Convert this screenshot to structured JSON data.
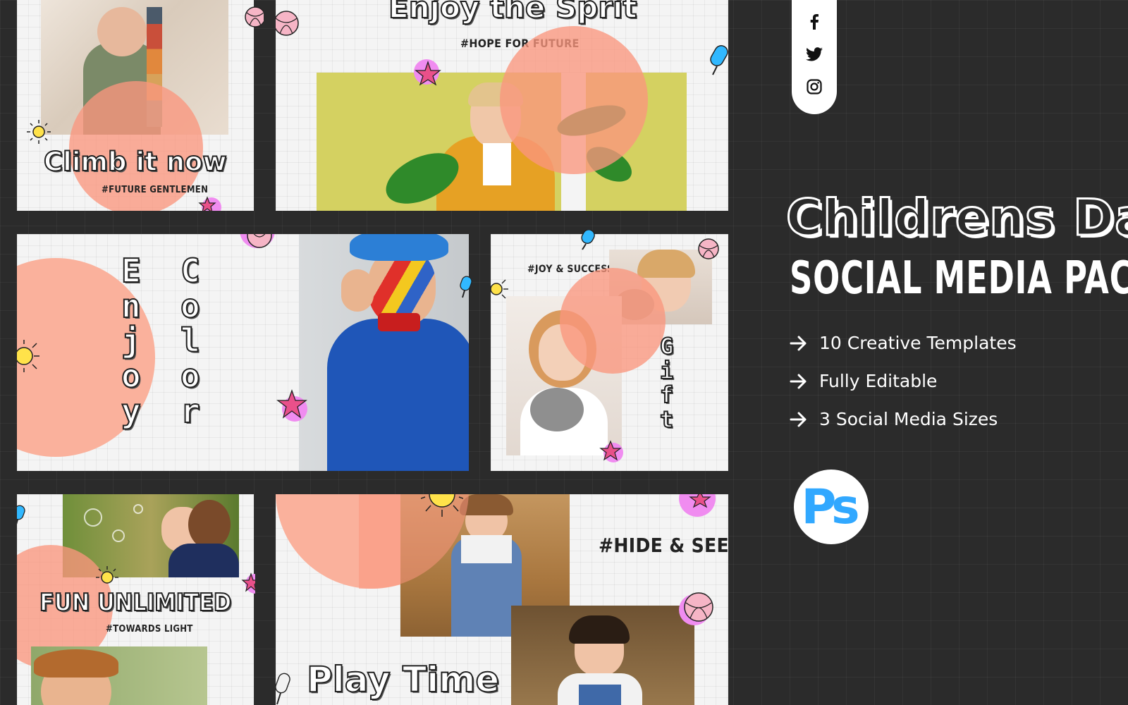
{
  "social": {
    "facebook_icon": "facebook-icon",
    "twitter_icon": "twitter-icon",
    "instagram_icon": "instagram-icon"
  },
  "product": {
    "title": "Childrens Day",
    "subtitle": "SOCIAL MEDIA PACK",
    "features": [
      "10 Creative Templates",
      "Fully Editable",
      "3 Social Media Sizes"
    ],
    "software_badge": "Ps"
  },
  "templates": {
    "climb": {
      "title": "Climb it now",
      "tag": "#FUTURE GENTLEMEN"
    },
    "spirit": {
      "title": "Enjoy the Sprit",
      "tag": "#HOPE FOR FUTURE"
    },
    "color": {
      "word1": [
        "E",
        "n",
        "j",
        "o",
        "y"
      ],
      "word2": [
        "C",
        "o",
        "l",
        "o",
        "r"
      ]
    },
    "gift": {
      "tag": "#JOY & SUCCESS",
      "word": [
        "G",
        "i",
        "f",
        "t"
      ]
    },
    "fun": {
      "title": "FUN UNLIMITED",
      "tag": "#TOWARDS LIGHT"
    },
    "play": {
      "title": "Play Time",
      "tag": "#HIDE & SEEK"
    }
  },
  "colors": {
    "background": "#2b2b2b",
    "blob": "#fa967d",
    "accent_blue": "#31a8ff",
    "pink": "#f08cf0"
  }
}
